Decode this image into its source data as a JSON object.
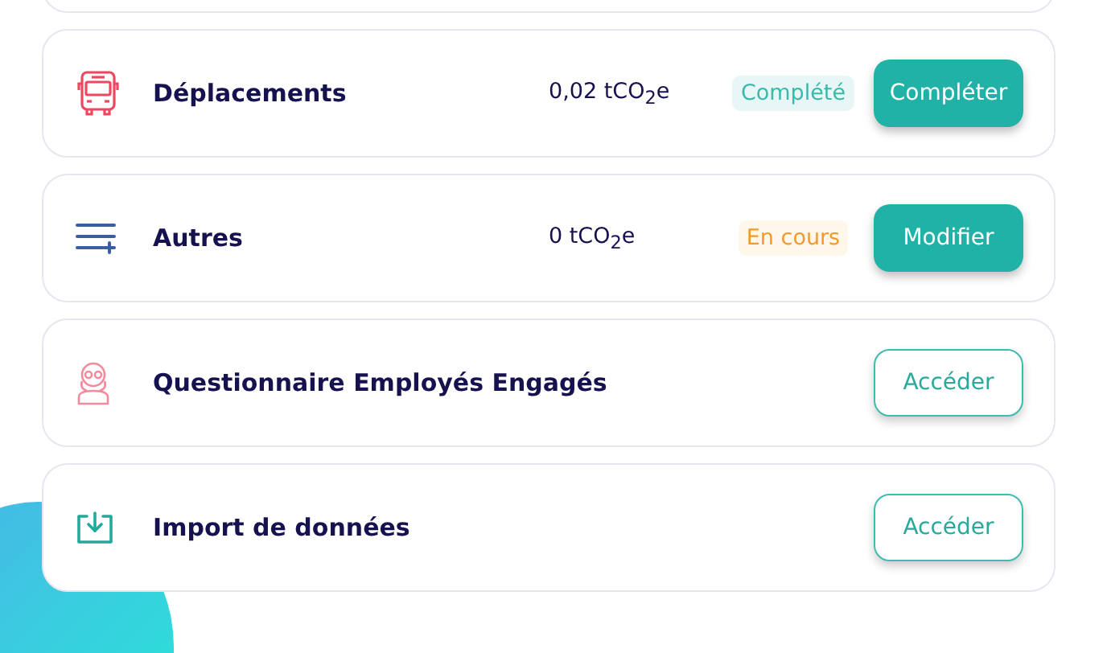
{
  "items": [
    {
      "kind": "bus",
      "title": "Déplacements",
      "value": "0,02 tCO$_{2}$e",
      "status": {
        "kind": "complete",
        "label": "Complété"
      },
      "button": {
        "kind": "filled",
        "label": "Compléter"
      }
    },
    {
      "kind": "list",
      "title": "Autres",
      "value": "0 tCO$_{2}$e",
      "status": {
        "kind": "in_progress",
        "label": "En cours"
      },
      "button": {
        "kind": "filled",
        "label": "Modifier"
      }
    },
    {
      "kind": "person",
      "title": "Questionnaire Employés Engagés",
      "button": {
        "kind": "outline",
        "label": "Accéder"
      }
    },
    {
      "kind": "download",
      "title": "Import de données",
      "button": {
        "kind": "outline",
        "label": "Accéder"
      }
    }
  ]
}
